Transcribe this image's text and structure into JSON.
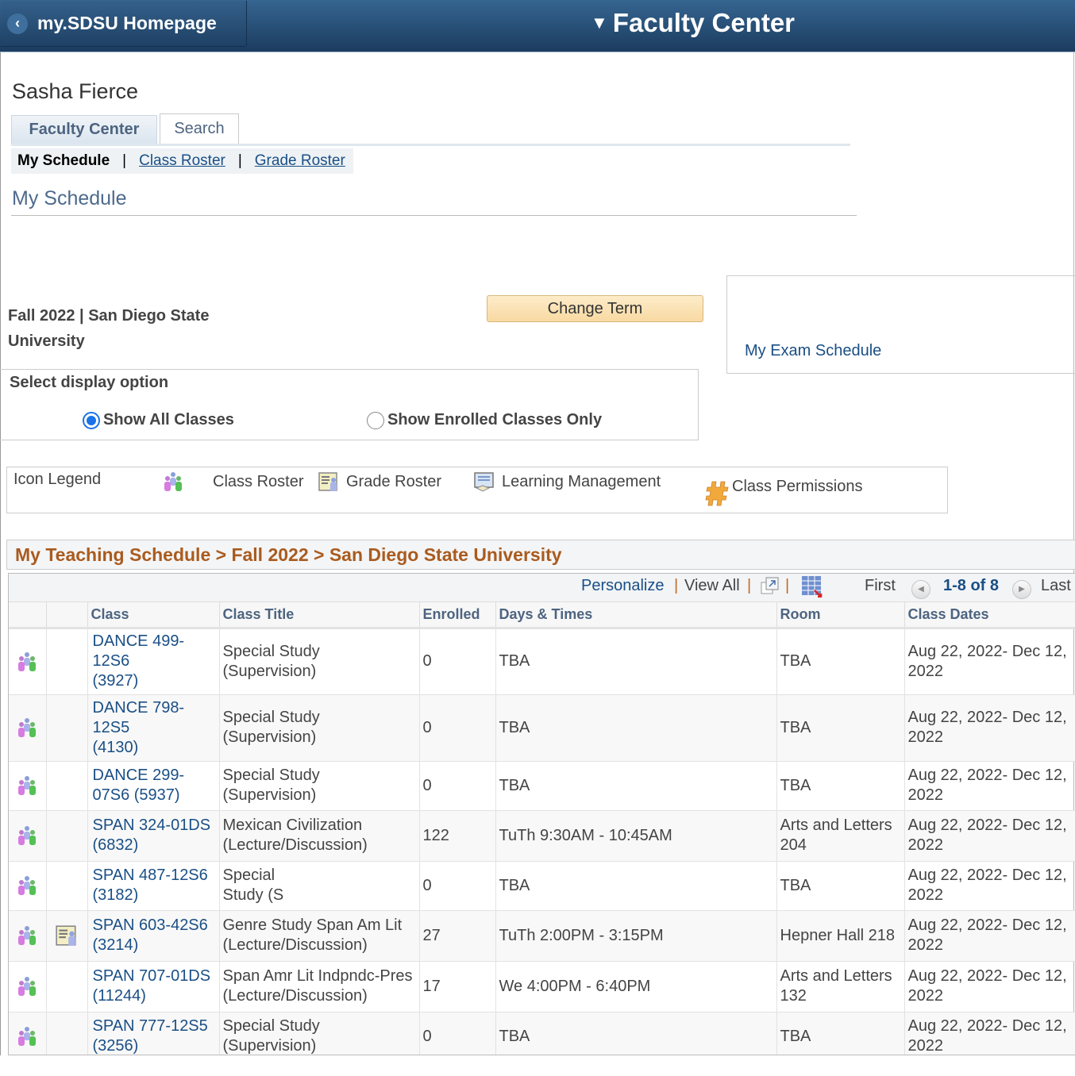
{
  "topbar": {
    "home_label": "my.SDSU Homepage",
    "page_title": "Faculty Center"
  },
  "user": {
    "name": "Sasha Fierce"
  },
  "tabs": [
    {
      "label": "Faculty Center",
      "active": true
    },
    {
      "label": "Search",
      "active": false
    }
  ],
  "subnav": {
    "current": "My Schedule",
    "links": [
      "Class Roster",
      "Grade Roster"
    ]
  },
  "section_title": "My Schedule",
  "term": {
    "line1": "Fall 2022 | San Diego State",
    "line2": "University",
    "change_term_label": "Change Term"
  },
  "exam_link": "My Exam Schedule",
  "display_option": {
    "label": "Select display option",
    "options": [
      {
        "label": "Show All Classes",
        "selected": true
      },
      {
        "label": "Show Enrolled Classes Only",
        "selected": false
      }
    ]
  },
  "legend": {
    "title": "Icon Legend",
    "items": [
      {
        "icon": "class-roster-icon",
        "label": "Class Roster"
      },
      {
        "icon": "grade-roster-icon",
        "label": "Grade Roster"
      },
      {
        "icon": "learning-management-icon",
        "label": "Learning Management"
      },
      {
        "icon": "class-permissions-icon",
        "label": "Class Permissions"
      }
    ]
  },
  "schedule": {
    "header": "My Teaching Schedule > Fall 2022 > San Diego State University",
    "toolbar": {
      "personalize": "Personalize",
      "view_all": "View All",
      "first": "First",
      "range": "1-8 of 8",
      "last": "Last"
    },
    "columns": [
      "",
      "",
      "Class",
      "Class Title",
      "Enrolled",
      "Days & Times",
      "Room",
      "Class Dates"
    ],
    "rows": [
      {
        "roster": true,
        "grade": false,
        "class": "DANCE 499-\n12S6\n(3927)",
        "title": "Special Study (Supervision)",
        "enrolled": "0",
        "days_times": "TBA",
        "room": "TBA",
        "dates": "Aug 22, 2022- Dec 12, 2022"
      },
      {
        "roster": true,
        "grade": false,
        "class": "DANCE 798-\n12S5\n(4130)",
        "title": "Special Study (Supervision)",
        "enrolled": "0",
        "days_times": "TBA",
        "room": "TBA",
        "dates": "Aug 22, 2022- Dec 12, 2022"
      },
      {
        "roster": true,
        "grade": false,
        "class": "DANCE 299-07S6 (5937)",
        "title": "Special Study (Supervision)",
        "enrolled": "0",
        "days_times": "TBA",
        "room": "TBA",
        "dates": "Aug 22, 2022- Dec 12, 2022"
      },
      {
        "roster": true,
        "grade": false,
        "class": "SPAN 324-01DS (6832)",
        "title": "Mexican Civilization (Lecture/Discussion)",
        "enrolled": "122",
        "days_times": "TuTh 9:30AM - 10:45AM",
        "room": "Arts and Letters 204",
        "dates": "Aug 22, 2022- Dec 12, 2022"
      },
      {
        "roster": true,
        "grade": false,
        "class": "SPAN 487-12S6 (3182)",
        "title": "Special Study (Supervision)",
        "enrolled": "0",
        "days_times": "TBA",
        "room": "TBA",
        "dates": "Aug 22, 2022- Dec 12, 2022",
        "title_clipped": true
      },
      {
        "roster": true,
        "grade": true,
        "class": "SPAN 603-42S6 (3214)",
        "title": "Genre Study Span Am Lit (Lecture/Discussion)",
        "enrolled": "27",
        "days_times": "TuTh 2:00PM - 3:15PM",
        "room": "Hepner Hall 218",
        "dates": "Aug 22, 2022- Dec 12, 2022"
      },
      {
        "roster": true,
        "grade": false,
        "class": "SPAN 707-01DS (11244)",
        "title": "Span Amr Lit Indpndc-Pres (Lecture/Discussion)",
        "enrolled": "17",
        "days_times": "We 4:00PM - 6:40PM",
        "room": "Arts and Letters 132",
        "dates": "Aug 22, 2022- Dec 12, 2022"
      },
      {
        "roster": true,
        "grade": false,
        "class": "SPAN 777-12S5 (3256)",
        "title": "Special Study (Supervision)",
        "enrolled": "0",
        "days_times": "TBA",
        "room": "TBA",
        "dates": "Aug 22, 2022- Dec 12, 2022"
      }
    ]
  }
}
